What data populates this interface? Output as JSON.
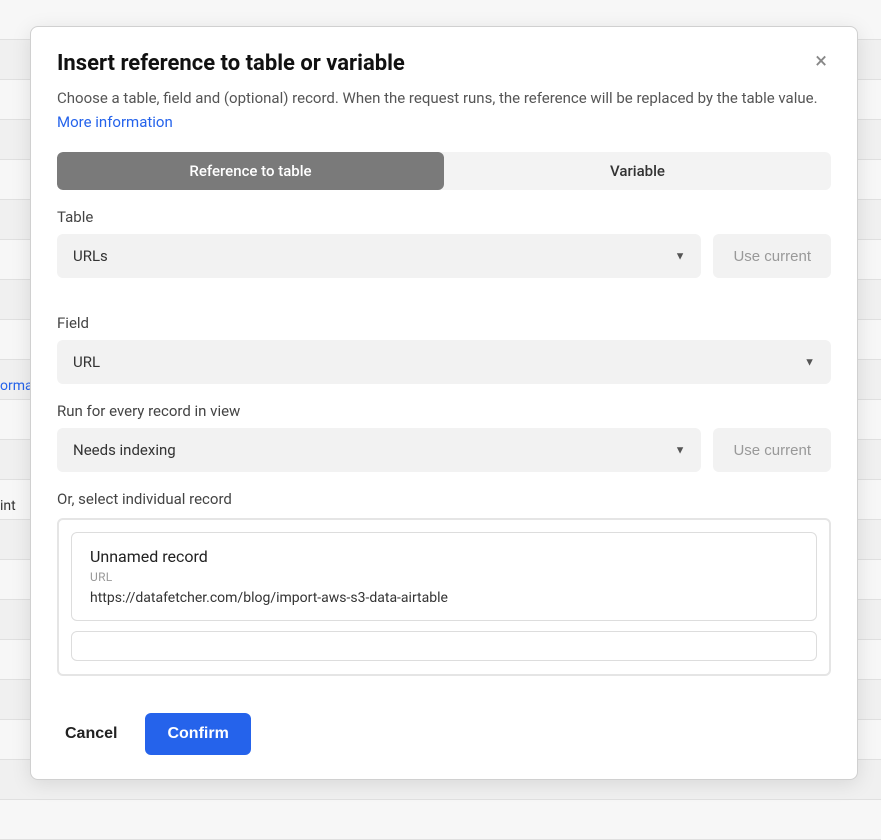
{
  "modal": {
    "title": "Insert reference to table or variable",
    "description": "Choose a table, field and (optional) record. When the request runs, the reference will be replaced by the table value.",
    "more_info_label": "More information",
    "close_label": "×"
  },
  "tabs": {
    "reference": "Reference to table",
    "variable": "Variable"
  },
  "form": {
    "table_label": "Table",
    "table_value": "URLs",
    "use_current_label": "Use current",
    "field_label": "Field",
    "field_value": "URL",
    "view_label": "Run for every record in view",
    "view_value": "Needs indexing",
    "record_label": "Or, select individual record"
  },
  "records": [
    {
      "title": "Unnamed record",
      "field_name": "URL",
      "value": "https://datafetcher.com/blog/import-aws-s3-data-airtable"
    }
  ],
  "footer": {
    "cancel": "Cancel",
    "confirm": "Confirm"
  }
}
